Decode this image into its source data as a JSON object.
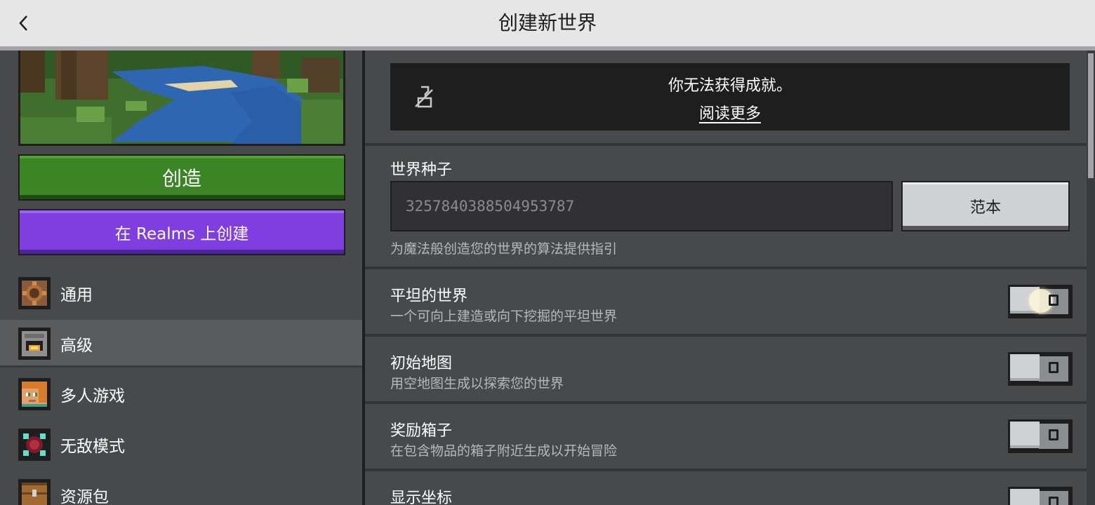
{
  "header": {
    "title": "创建新世界"
  },
  "sidebar": {
    "create_label": "创造",
    "realms_label": "在 Realms 上创建",
    "items": [
      {
        "label": "通用",
        "icon": "gear-block-icon"
      },
      {
        "label": "高级",
        "icon": "furnace-icon",
        "selected": true
      },
      {
        "label": "多人游戏",
        "icon": "alex-head-icon"
      },
      {
        "label": "无敌模式",
        "icon": "end-crystal-icon"
      },
      {
        "label": "资源包",
        "icon": "chest-icon"
      }
    ]
  },
  "main": {
    "banner": {
      "message": "你无法获得成就。",
      "link": "阅读更多",
      "icon": "no-achievement-icon"
    },
    "seed": {
      "title": "世界种子",
      "value": "3257840388504953787",
      "button": "范本",
      "description": "为魔法般创造您的世界的算法提供指引"
    },
    "options": [
      {
        "title": "平坦的世界",
        "description": "一个可向上建造或向下挖掘的平坦世界",
        "enabled": false
      },
      {
        "title": "初始地图",
        "description": "用空地图生成以探索您的世界",
        "enabled": false
      },
      {
        "title": "奖励箱子",
        "description": "在包含物品的箱子附近生成以开始冒险",
        "enabled": false
      },
      {
        "title": "显示坐标",
        "description": "",
        "enabled": false
      }
    ]
  },
  "colors": {
    "create_green": "#3c8527",
    "realms_purple": "#7f3fe0",
    "panel_gray": "#48494a",
    "dark": "#1e1e1f"
  }
}
